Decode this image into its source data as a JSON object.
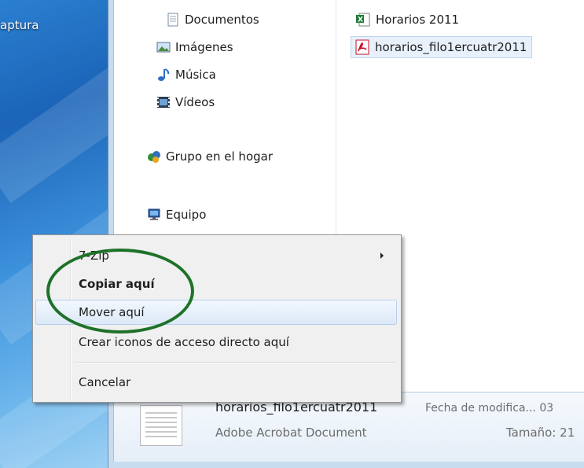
{
  "desktop": {
    "label": "aptura"
  },
  "navigation": {
    "libraries": [
      {
        "label": "Documentos",
        "icon": "documents-icon"
      },
      {
        "label": "Imágenes",
        "icon": "pictures-icon"
      },
      {
        "label": "Música",
        "icon": "music-icon"
      },
      {
        "label": "Vídeos",
        "icon": "videos-icon"
      }
    ],
    "homegroup": {
      "label": "Grupo en el hogar",
      "icon": "homegroup-icon"
    },
    "computer": {
      "label": "Equipo",
      "icon": "computer-icon"
    }
  },
  "files": [
    {
      "name": "Horarios 2011",
      "icon": "excel-icon",
      "selected": false
    },
    {
      "name": "horarios_filo1ercuatr2011",
      "icon": "pdf-icon",
      "selected": true
    }
  ],
  "details": {
    "name": "horarios_filo1ercuatr2011",
    "type": "Adobe Acrobat Document",
    "date_label": "Fecha de modifica... 03",
    "size_label": "Tamaño: 21"
  },
  "context_menu": {
    "items": [
      {
        "label": "7-Zip",
        "has_submenu": true,
        "bold": false,
        "highlighted": false
      },
      {
        "label": "Copiar aquí",
        "has_submenu": false,
        "bold": true,
        "highlighted": false
      },
      {
        "label": "Mover aquí",
        "has_submenu": false,
        "bold": false,
        "highlighted": true
      },
      {
        "label": "Crear iconos de acceso directo aquí",
        "has_submenu": false,
        "bold": false,
        "highlighted": false
      },
      {
        "label": "Cancelar",
        "has_submenu": false,
        "bold": false,
        "highlighted": false
      }
    ]
  },
  "annotation": {
    "color": "#1e7228"
  },
  "colors": {
    "menu_background": "#f0f0f0",
    "menu_highlight": "#dde9f8",
    "selection": "#e8f1fb",
    "pdf_red": "#c8102e",
    "excel_green": "#1f7a3a"
  }
}
